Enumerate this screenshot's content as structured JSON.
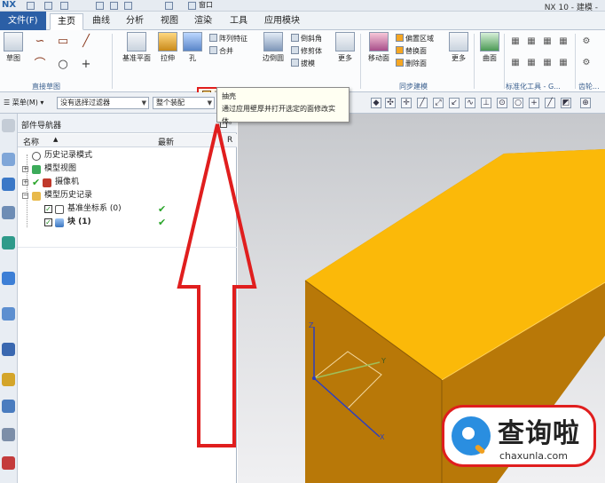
{
  "titlebar": {
    "logo": "NX",
    "title": "NX 10 - 建模 -",
    "window_menu": "窗口"
  },
  "tabs": [
    "文件(F)",
    "主页",
    "曲线",
    "分析",
    "视图",
    "渲染",
    "工具",
    "应用模块"
  ],
  "ribbon": {
    "sketch_label": "草图",
    "group_direct_sketch": "直接草图",
    "datum_plane": "基准平面",
    "extrude": "拉伸",
    "hole": "孔",
    "pattern_feature": "阵列特征",
    "unite": "合并",
    "shell": "抽壳",
    "edge_blend": "边倒圆",
    "chamfer": "倒斜角",
    "trim_body": "修剪体",
    "draft": "拔模",
    "more_1": "更多",
    "move_face": "移动面",
    "offset_region": "偏置区域",
    "replace_face": "替换面",
    "delete_face": "删除面",
    "group_sync": "同步建模",
    "more_2": "更多",
    "surface": "曲面",
    "group_std_tools": "标准化工具 - G...",
    "group_gear": "齿轮..."
  },
  "filterbar": {
    "menu": "菜单(M)",
    "filter": "没有选择过滤器",
    "assembly": "整个装配"
  },
  "tooltip": {
    "title": "抽壳",
    "description": "通过应用壁厚并打开选定的面修改实体。"
  },
  "navigator": {
    "title": "部件导航器",
    "col_name": "名称",
    "col_latest": "最新",
    "col_extra": "R",
    "rows": [
      {
        "label": "历史记录模式",
        "latest": ""
      },
      {
        "label": "模型视图",
        "latest": ""
      },
      {
        "label": "摄像机",
        "latest": ""
      },
      {
        "label": "模型历史记录",
        "latest": ""
      },
      {
        "label": "基准坐标系 (0)",
        "latest": "✔"
      },
      {
        "label": "块 (1)",
        "latest": "✔"
      }
    ]
  },
  "viewport": {
    "axis_y": "Y",
    "axis_z": "Z",
    "axis_x": "X"
  },
  "watermark": {
    "cn": "查询啦",
    "url": "chaxunla.com"
  },
  "colors": {
    "block_top": "#fbb909",
    "block_front": "#b87808",
    "annotation_red": "#e01e1e",
    "file_tab": "#2b5fa6"
  }
}
